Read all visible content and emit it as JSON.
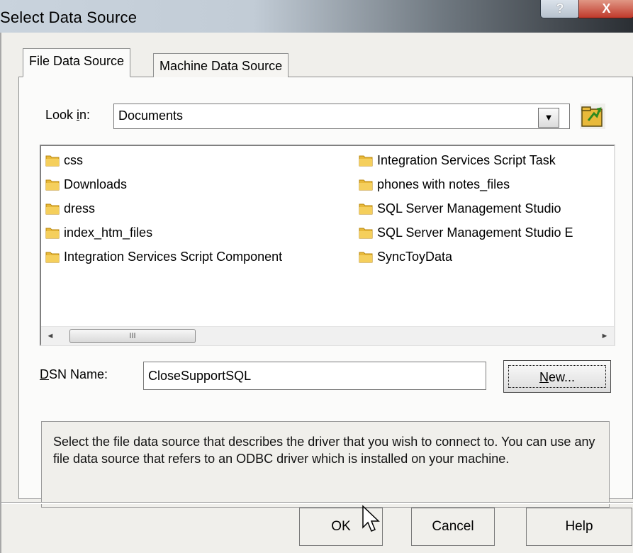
{
  "window": {
    "title": "Select Data Source",
    "help_glyph": "?",
    "close_glyph": "X"
  },
  "tabs": [
    {
      "label": "File Data Source",
      "active": true
    },
    {
      "label": "Machine Data Source",
      "active": false
    }
  ],
  "look_in": {
    "label_prefix": "Look ",
    "label_accel": "i",
    "label_suffix": "n:",
    "value": "Documents",
    "arrow_glyph": "▼"
  },
  "files": [
    {
      "name": "css",
      "icon": "folder-icon"
    },
    {
      "name": "Downloads",
      "icon": "folder-icon"
    },
    {
      "name": "dress",
      "icon": "folder-icon"
    },
    {
      "name": "index_htm_files",
      "icon": "folder-icon"
    },
    {
      "name": "Integration Services Script Component",
      "icon": "folder-icon"
    },
    {
      "name": "Integration Services Script Task",
      "icon": "folder-icon"
    },
    {
      "name": "phones with notes_files",
      "icon": "folder-icon"
    },
    {
      "name": "SQL Server Management Studio",
      "icon": "folder-icon"
    },
    {
      "name": "SQL Server Management Studio E",
      "icon": "folder-icon"
    },
    {
      "name": "SyncToyData",
      "icon": "folder-icon"
    }
  ],
  "scrollbar": {
    "left_glyph": "◄",
    "thumb_grip": "III",
    "right_glyph": "►"
  },
  "dsn": {
    "label_accel": "D",
    "label_rest": "SN Name:",
    "value": "CloseSupportSQL"
  },
  "new_button": {
    "accel": "N",
    "rest": "ew..."
  },
  "description": "Select the file data source that describes the driver that you wish to connect to. You can use any file data source that refers to an ODBC driver which is installed on your machine.",
  "buttons": {
    "ok": "OK",
    "cancel": "Cancel",
    "help": "Help"
  },
  "colors": {
    "folder": "#e8b93a",
    "close": "#c0392b"
  }
}
